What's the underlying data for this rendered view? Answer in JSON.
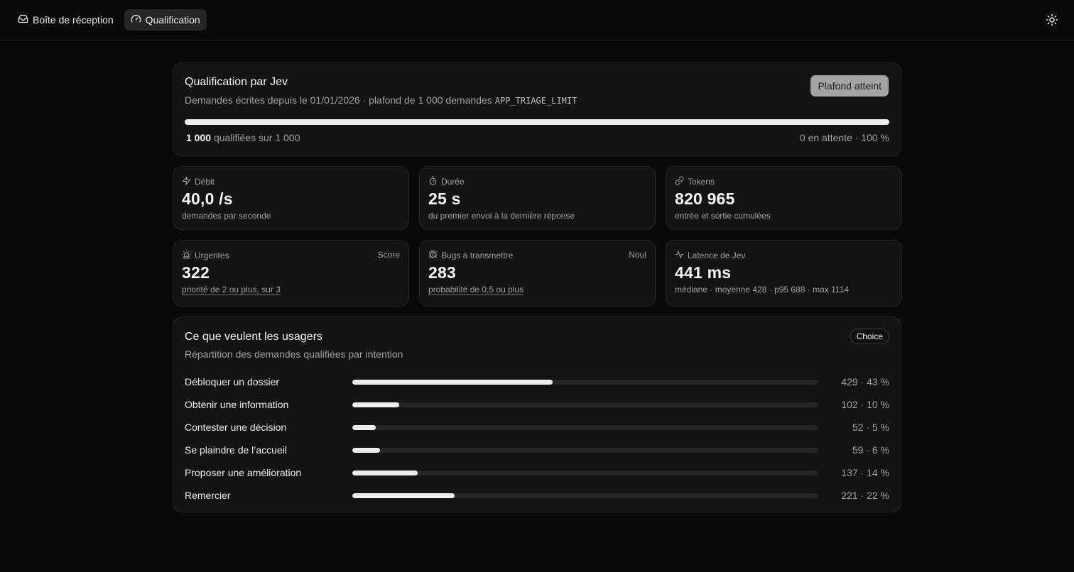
{
  "nav": {
    "tabs": [
      {
        "label": "Boîte de réception",
        "icon": "inbox-icon",
        "active": false
      },
      {
        "label": "Qualification",
        "icon": "gauge-icon",
        "active": true
      }
    ],
    "theme_icon": "theme-toggle-icon"
  },
  "quota": {
    "title": "Qualification par Jev",
    "subtitle": "Demandes écrites depuis le 01/01/2026 · plafond de 1 000 demandes",
    "env_var": "APP_TRIAGE_LIMIT",
    "badge": "Plafond atteint",
    "progress": 1.0,
    "qualified": "1 000",
    "qualified_suffix": "qualifiées sur 1 000",
    "pending": "0 en attente · 100 %"
  },
  "stats": [
    {
      "icon": "bolt-icon",
      "label": "Débit",
      "tag": "",
      "value": "40,0 /s",
      "desc": "demandes par seconde",
      "underline": false
    },
    {
      "icon": "stopwatch-icon",
      "label": "Durée",
      "tag": "",
      "value": "25 s",
      "desc": "du premier envoi à la dernière réponse",
      "underline": false
    },
    {
      "icon": "link-icon",
      "label": "Tokens",
      "tag": "",
      "value": "820 965",
      "desc": "entrée et sortie cumulées",
      "underline": false
    },
    {
      "icon": "siren-icon",
      "label": "Urgentes",
      "tag": "Score",
      "value": "322",
      "desc": "priorité de 2 ou plus, sur 3",
      "underline": true
    },
    {
      "icon": "bug-icon",
      "label": "Bugs à transmettre",
      "tag": "Noul",
      "value": "283",
      "desc": "probabilité de 0,5 ou plus",
      "underline": true
    },
    {
      "icon": "pulse-icon",
      "label": "Latence de Jev",
      "tag": "",
      "value": "441 ms",
      "desc": "médiane · moyenne 428 · p95 688 · max 1114",
      "underline": false
    }
  ],
  "intents": {
    "title": "Ce que veulent les usagers",
    "subtitle": "Répartition des demandes qualifiées par intention",
    "pill": "Choice",
    "rows": [
      {
        "label": "Débloquer un dossier",
        "count": 429,
        "pct": 43,
        "value": "429 · 43 %"
      },
      {
        "label": "Obtenir une information",
        "count": 102,
        "pct": 10,
        "value": "102 · 10 %"
      },
      {
        "label": "Contester une décision",
        "count": 52,
        "pct": 5,
        "value": "52 · 5 %"
      },
      {
        "label": "Se plaindre de l’accueil",
        "count": 59,
        "pct": 6,
        "value": "59 · 6 %"
      },
      {
        "label": "Proposer une amélioration",
        "count": 137,
        "pct": 14,
        "value": "137 · 14 %"
      },
      {
        "label": "Remercier",
        "count": 221,
        "pct": 22,
        "value": "221 · 22 %"
      }
    ]
  }
}
